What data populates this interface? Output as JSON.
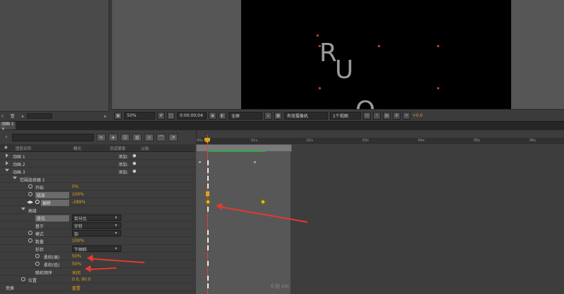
{
  "viewer_bar": {
    "zoom": "50%",
    "timecode": "0:00:00:04",
    "resolution": "全屏",
    "camera": "有效摄像机",
    "view_count": "1个视图",
    "exposure": "+0.0"
  },
  "composition_glyphs": [
    "R",
    "U",
    "O"
  ],
  "timeline": {
    "tab_label": "动画 1 ×",
    "columns": {
      "name": "图层名称",
      "mode": "模式",
      "trkmat": "轨道蒙版",
      "parent": "父级"
    },
    "ruler_labels": [
      "00s",
      "01s",
      "02s",
      "03s",
      "04s",
      "05s",
      "06s"
    ],
    "rows": [
      {
        "label": "动画 1",
        "right": "添加:"
      },
      {
        "label": "动画 2",
        "right": "添加:"
      },
      {
        "label": "动画 3",
        "right": "添加:"
      },
      {
        "label": "范围选择器 1"
      },
      {
        "label": "开始",
        "value": "0%"
      },
      {
        "label": "结束",
        "value": "100%"
      },
      {
        "label": "偏移",
        "value": "-289%"
      },
      {
        "label": "高级"
      },
      {
        "label": "单位",
        "value": "百分比"
      },
      {
        "label": "基于",
        "value": "字符"
      },
      {
        "label": "模式",
        "value": "加"
      },
      {
        "label": "数量",
        "value": "100%"
      },
      {
        "label": "形状",
        "value": "下倾斜"
      },
      {
        "label": "柔和(高)",
        "value": "50%"
      },
      {
        "label": "柔和(低)",
        "value": "50%"
      },
      {
        "label": "随机顺序",
        "value": "关闭"
      },
      {
        "label": "位置",
        "value": "0.0, 90.0"
      },
      {
        "label": "变换",
        "value": "重置"
      }
    ]
  },
  "watermark": "©创 xin"
}
